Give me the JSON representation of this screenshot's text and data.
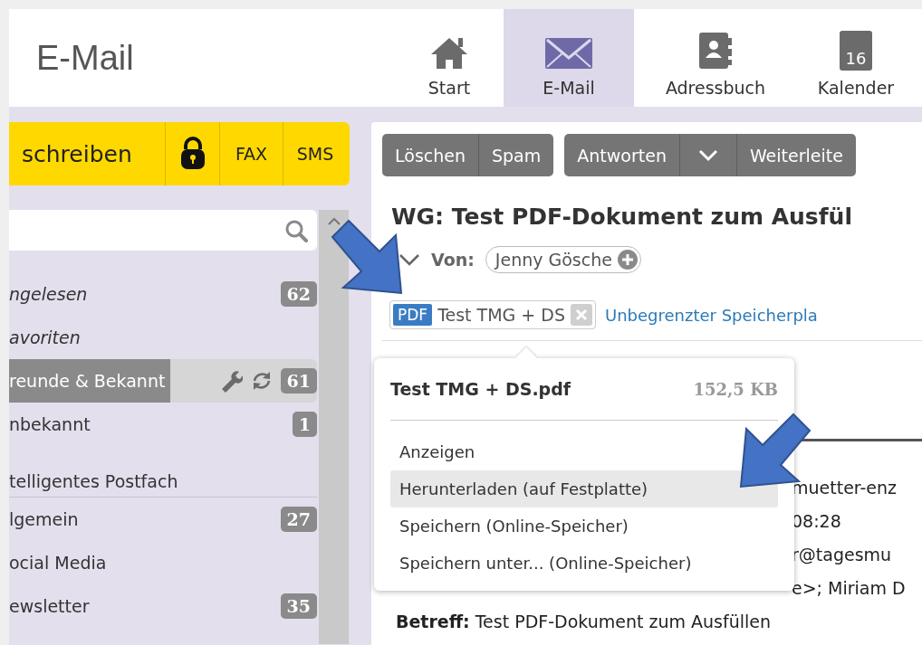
{
  "header": {
    "title": "E-Mail"
  },
  "nav": [
    {
      "label": "Start",
      "selected": false
    },
    {
      "label": "E-Mail",
      "selected": true
    },
    {
      "label": "Adressbuch",
      "selected": false
    },
    {
      "label": "Kalender",
      "icon_text": "16",
      "selected": false
    }
  ],
  "compose_bar": {
    "compose": "schreiben",
    "fax": "FAX",
    "sms": "SMS"
  },
  "sidebar": {
    "items": [
      {
        "kind": "smart",
        "label": "ngelesen",
        "count": "62",
        "selected": false
      },
      {
        "kind": "smart",
        "label": "avoriten",
        "selected": false
      },
      {
        "kind": "folder",
        "label": "reunde & Bekannt",
        "count": "61",
        "selected": true
      },
      {
        "kind": "folder",
        "label": "nbekannt",
        "count": "1",
        "selected": false
      },
      {
        "kind": "header",
        "label": "telligentes Postfach"
      },
      {
        "kind": "folder",
        "label": "lgemein",
        "count": "27",
        "selected": false
      },
      {
        "kind": "folder",
        "label": "ocial Media",
        "selected": false
      },
      {
        "kind": "folder",
        "label": "ewsletter",
        "count": "35",
        "selected": false
      }
    ]
  },
  "toolbar": {
    "groups": [
      {
        "buttons": [
          {
            "kind": "label",
            "label": "Löschen"
          },
          {
            "kind": "label",
            "label": "Spam"
          }
        ]
      },
      {
        "buttons": [
          {
            "kind": "label",
            "label": "Antworten"
          },
          {
            "kind": "chevron"
          },
          {
            "kind": "label",
            "label": "Weiterleite"
          }
        ]
      }
    ]
  },
  "message": {
    "subject": "WG: Test PDF-Dokument zum Ausfül",
    "from_label": "Von:",
    "sender": "Jenny Gösche",
    "attachment": {
      "type": "PDF",
      "name": "Test TMG + DS"
    },
    "storage_link": "Unbegrenzter Speicherpla",
    "body_lines": [
      {
        "kind": "fragment",
        "text": "muetter-enz"
      },
      {
        "kind": "fragment",
        "text": "08:28"
      },
      {
        "kind": "fragment",
        "text": "r@tagesmu"
      },
      {
        "kind": "fragment",
        "text": "e>; Miriam D"
      },
      {
        "kind": "field",
        "label": "Betreff:",
        "text": "Test PDF-Dokument zum Ausfüllen"
      }
    ]
  },
  "attachment_menu": {
    "filename": "Test TMG + DS.pdf",
    "size": "152,5 KB",
    "items": [
      {
        "label": "Anzeigen",
        "selected": false
      },
      {
        "label": "Herunterladen (auf Festplatte)",
        "selected": true
      },
      {
        "label": "Speichern (Online-Speicher)",
        "selected": false
      },
      {
        "label": "Speichern unter... (Online-Speicher)",
        "selected": false
      }
    ]
  }
}
